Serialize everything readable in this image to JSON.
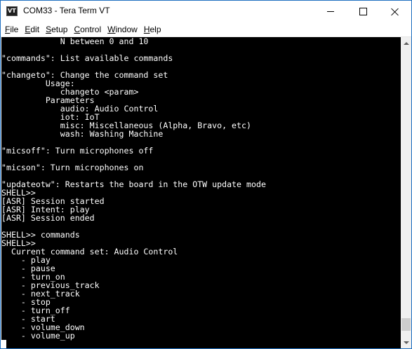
{
  "window": {
    "title": "COM33 - Tera Term VT",
    "app_icon": "teraterm-vt-icon"
  },
  "menu": [
    {
      "accel": "F",
      "rest": "ile"
    },
    {
      "accel": "E",
      "rest": "dit"
    },
    {
      "accel": "S",
      "rest": "etup"
    },
    {
      "accel": "C",
      "rest": "ontrol"
    },
    {
      "accel": "W",
      "rest": "indow"
    },
    {
      "accel": "H",
      "rest": "elp"
    }
  ],
  "terminal": {
    "lines": [
      "            N between 0 and 10",
      "",
      "\"commands\": List available commands",
      "",
      "\"changeto\": Change the command set",
      "         Usage:",
      "            changeto <param>",
      "         Parameters",
      "            audio: Audio Control",
      "            iot: IoT",
      "            misc: Miscellaneous (Alpha, Bravo, etc)",
      "            wash: Washing Machine",
      "",
      "\"micsoff\": Turn microphones off",
      "",
      "\"micson\": Turn microphones on",
      "",
      "\"updateotw\": Restarts the board in the OTW update mode",
      "SHELL>>",
      "[ASR] Session started",
      "[ASR] Intent: play",
      "[ASR] Session ended",
      "",
      "SHELL>> commands",
      "SHELL>>",
      "  Current command set: Audio Control",
      "    - play",
      "    - pause",
      "    - turn_on",
      "    - previous_track",
      "    - next_track",
      "    - stop",
      "    - turn_off",
      "    - start",
      "    - volume_down",
      "    - volume_up",
      ""
    ]
  },
  "scrollbar": {
    "up_icon": "scroll-up-arrow-icon",
    "down_icon": "scroll-down-arrow-icon",
    "position_fraction": 0.98
  },
  "colors": {
    "terminal_bg": "#000000",
    "terminal_fg": "#ffffff",
    "window_border": "#1e6fc0"
  }
}
